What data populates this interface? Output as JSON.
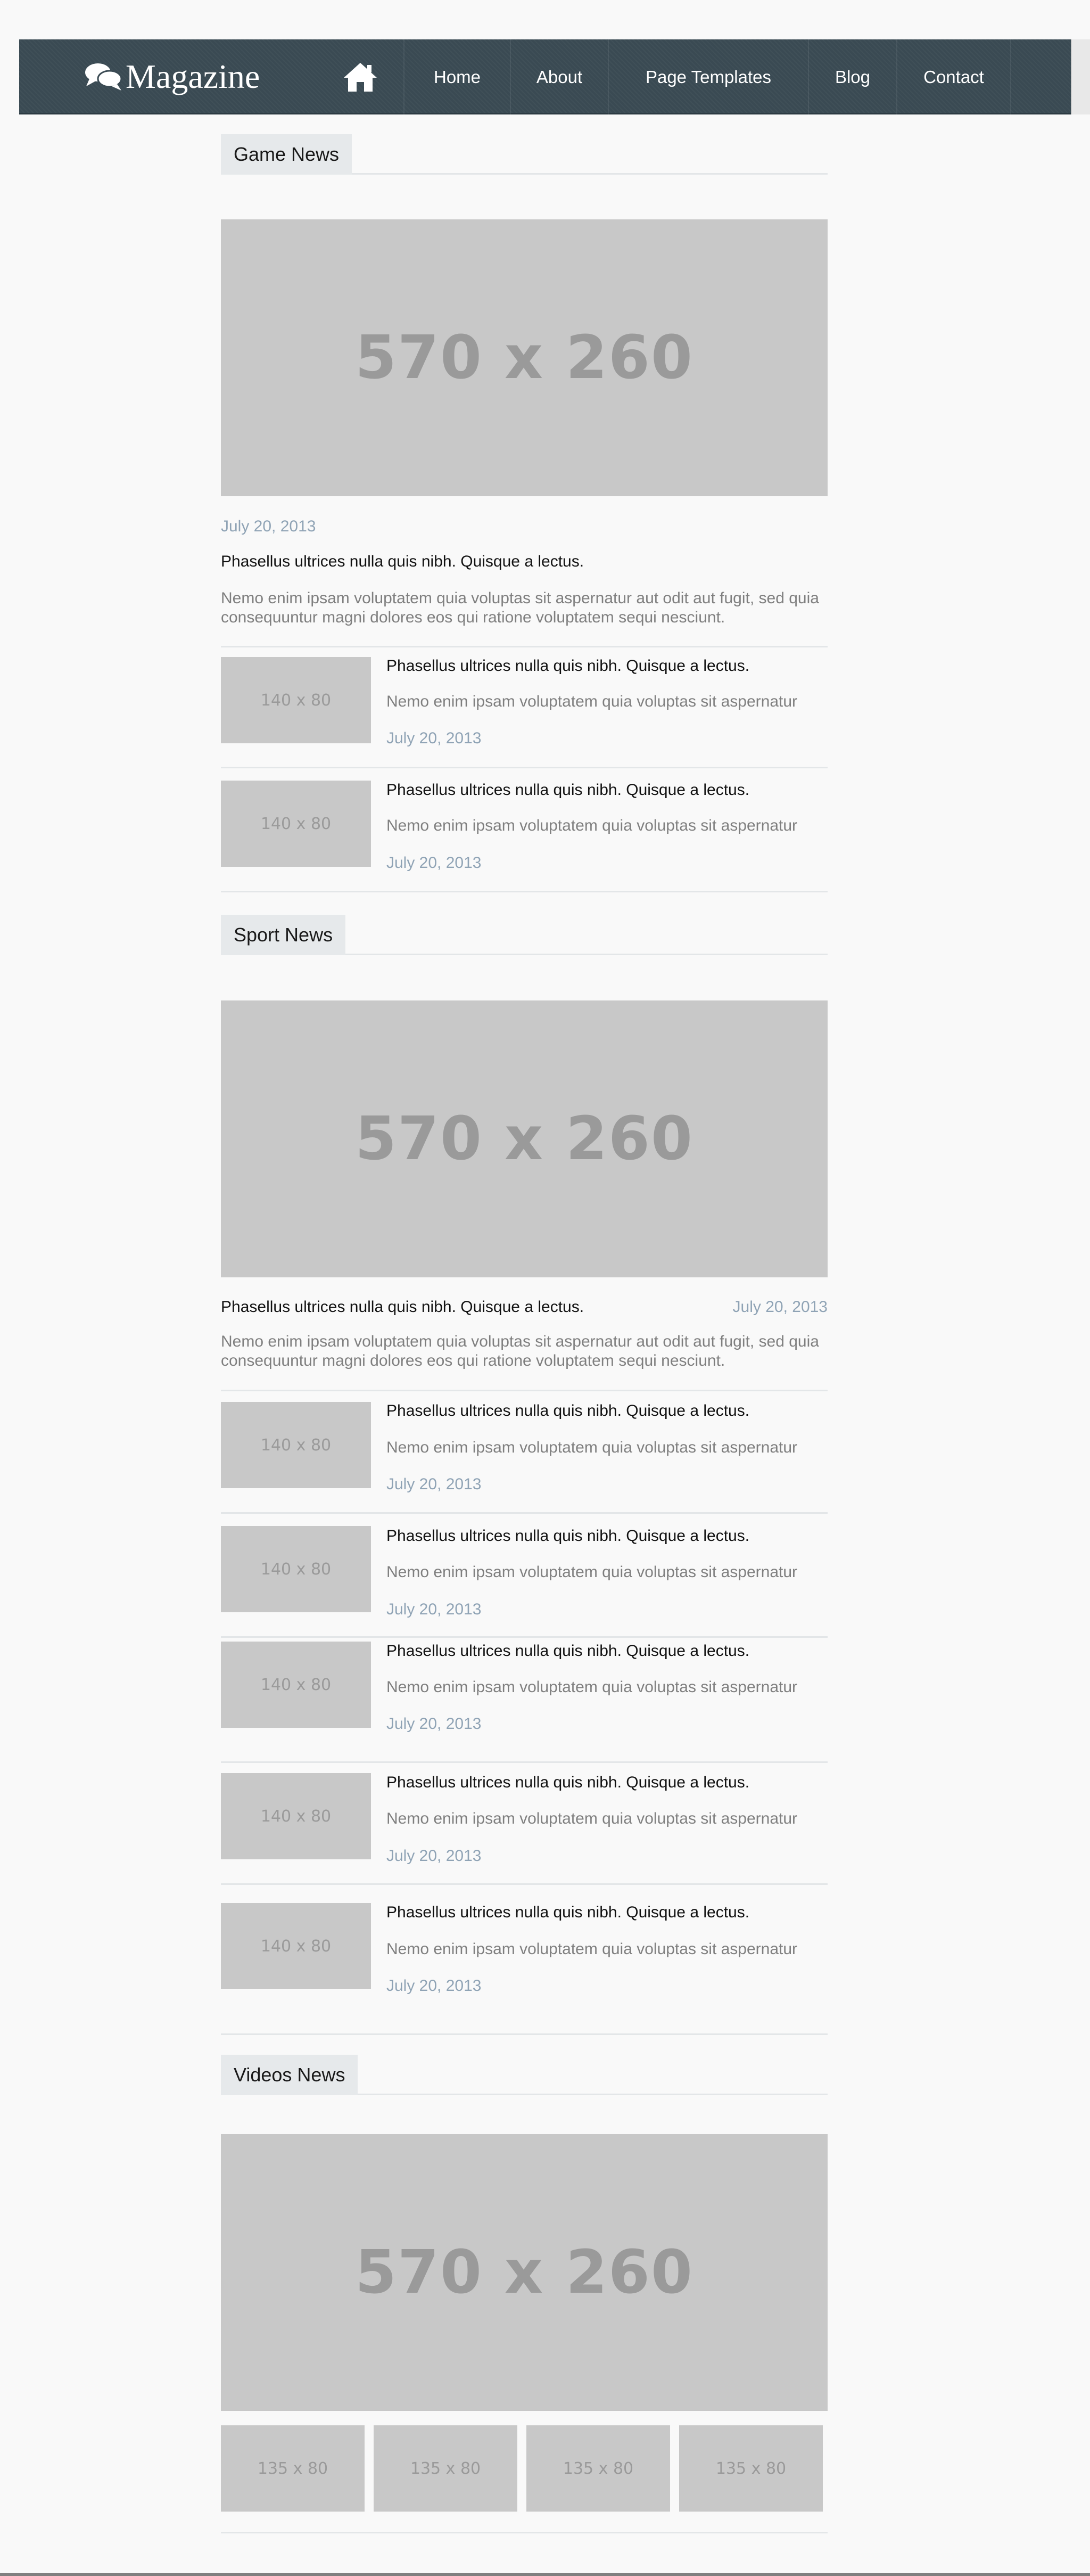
{
  "header": {
    "brand": "Magazine",
    "nav": [
      "Home",
      "About",
      "Page Templates",
      "Blog",
      "Contact"
    ]
  },
  "game": {
    "heading": "Game News",
    "featured": {
      "image_label": "570 x 260",
      "date": "July 20, 2013",
      "title": "Phasellus ultrices nulla quis nibh. Quisque a lectus.",
      "desc": "Nemo enim ipsam voluptatem quia voluptas sit aspernatur aut odit aut fugit, sed quia consequuntur magni dolores eos qui ratione voluptatem sequi nesciunt."
    },
    "items": [
      {
        "image_label": "140 x 80",
        "title": "Phasellus ultrices nulla quis nibh. Quisque a lectus.",
        "desc": "Nemo enim ipsam voluptatem quia voluptas sit aspernatur",
        "date": "July 20, 2013"
      },
      {
        "image_label": "140 x 80",
        "title": "Phasellus ultrices nulla quis nibh. Quisque a lectus.",
        "desc": "Nemo enim ipsam voluptatem quia voluptas sit aspernatur",
        "date": "July 20, 2013"
      }
    ]
  },
  "sport": {
    "heading": "Sport News",
    "featured": {
      "image_label": "570 x 260",
      "title": "Phasellus ultrices nulla quis nibh. Quisque a lectus.",
      "date": "July 20, 2013",
      "desc": "Nemo enim ipsam voluptatem quia voluptas sit aspernatur aut odit aut fugit, sed quia consequuntur magni dolores eos qui ratione voluptatem sequi nesciunt."
    },
    "items": [
      {
        "image_label": "140 x 80",
        "title": "Phasellus ultrices nulla quis nibh. Quisque a lectus.",
        "desc": "Nemo enim ipsam voluptatem quia voluptas sit aspernatur",
        "date": "July 20, 2013"
      },
      {
        "image_label": "140 x 80",
        "title": "Phasellus ultrices nulla quis nibh. Quisque a lectus.",
        "desc": "Nemo enim ipsam voluptatem quia voluptas sit aspernatur",
        "date": "July 20, 2013"
      },
      {
        "image_label": "140 x 80",
        "title": "Phasellus ultrices nulla quis nibh. Quisque a lectus.",
        "desc": "Nemo enim ipsam voluptatem quia voluptas sit aspernatur",
        "date": "July 20, 2013"
      },
      {
        "image_label": "140 x 80",
        "title": "Phasellus ultrices nulla quis nibh. Quisque a lectus.",
        "desc": "Nemo enim ipsam voluptatem quia voluptas sit aspernatur",
        "date": "July 20, 2013"
      },
      {
        "image_label": "140 x 80",
        "title": "Phasellus ultrices nulla quis nibh. Quisque a lectus.",
        "desc": "Nemo enim ipsam voluptatem quia voluptas sit aspernatur",
        "date": "July 20, 2013"
      }
    ]
  },
  "videos": {
    "heading": "Videos News",
    "featured": {
      "image_label": "570 x 260"
    },
    "thumbs": [
      "135 x 80",
      "135 x 80",
      "135 x 80",
      "135 x 80"
    ]
  }
}
